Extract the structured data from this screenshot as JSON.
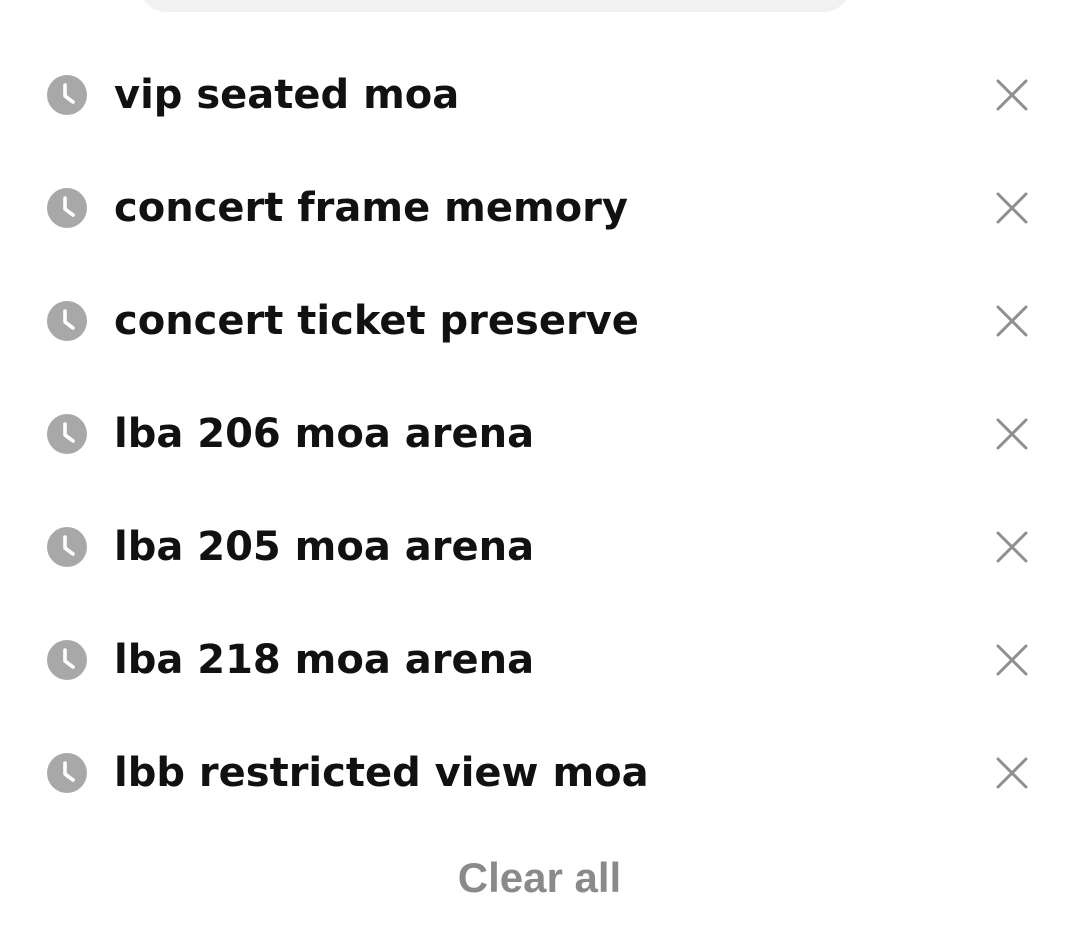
{
  "search_history": {
    "items": [
      {
        "label": "vip seated moa",
        "icon": "clock-icon",
        "remove_icon": "close-icon"
      },
      {
        "label": "concert frame memory",
        "icon": "clock-icon",
        "remove_icon": "close-icon"
      },
      {
        "label": "concert ticket preserve",
        "icon": "clock-icon",
        "remove_icon": "close-icon"
      },
      {
        "label": "lba 206 moa arena",
        "icon": "clock-icon",
        "remove_icon": "close-icon"
      },
      {
        "label": "lba 205 moa arena",
        "icon": "clock-icon",
        "remove_icon": "close-icon"
      },
      {
        "label": "lba 218 moa arena",
        "icon": "clock-icon",
        "remove_icon": "close-icon"
      },
      {
        "label": "lbb restricted view moa",
        "icon": "clock-icon",
        "remove_icon": "close-icon"
      }
    ],
    "clear_all_label": "Clear all"
  },
  "colors": {
    "text": "#111111",
    "icon_gray": "#a8a8a8",
    "close_gray": "#8f8f8f",
    "clear_all_gray": "#8a8a8a",
    "search_bar_bg": "#f1f1f1"
  }
}
